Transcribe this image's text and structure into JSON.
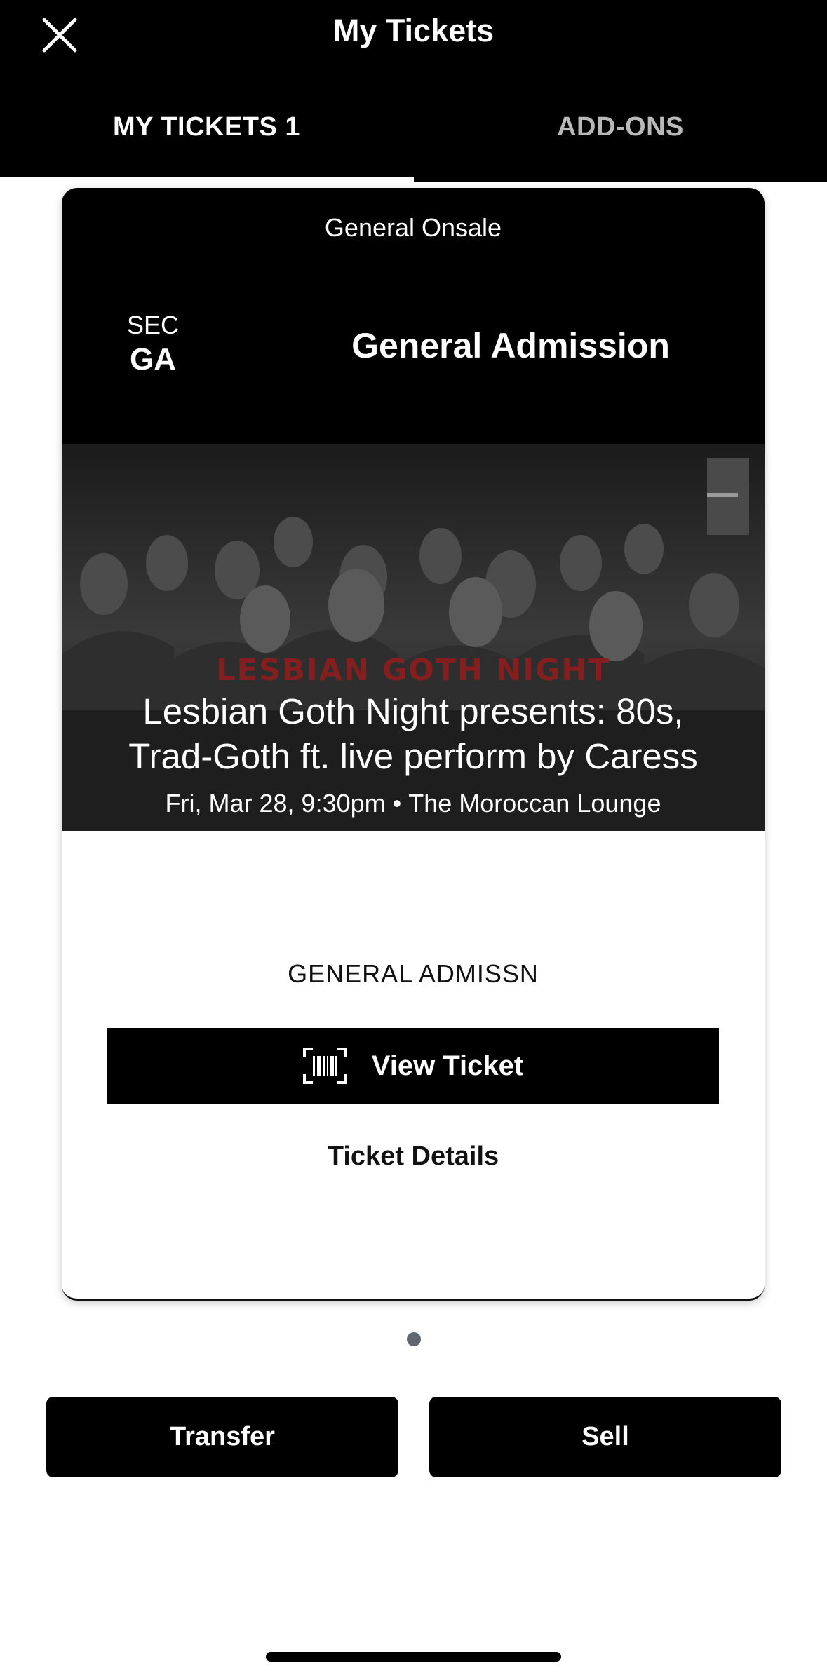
{
  "header": {
    "title": "My Tickets",
    "close_icon": "close-icon",
    "tabs": [
      {
        "label": "MY TICKETS 1",
        "active": true
      },
      {
        "label": "ADD-ONS",
        "active": false
      }
    ]
  },
  "ticket": {
    "onsale_label": "General Onsale",
    "section_label": "SEC",
    "section_value": "GA",
    "admission_title": "General Admission",
    "image_brand_text": "LESBIAN GOTH NIGHT",
    "event_name_line1": "Lesbian Goth Night presents: 80s,",
    "event_name_line2": "Trad-Goth ft. live perform by Caress",
    "event_date": "Fri, Mar 28, 9:30pm",
    "meta_separator": "•",
    "venue": "The Moroccan Lounge",
    "ticket_type": "GENERAL ADMISSN",
    "view_ticket_label": "View Ticket",
    "view_ticket_icon": "barcode-scan-icon",
    "ticket_details_label": "Ticket Details"
  },
  "pager": {
    "current": 1,
    "total": 1
  },
  "actions": {
    "transfer_label": "Transfer",
    "sell_label": "Sell"
  },
  "colors": {
    "header_bg": "#000000",
    "active_tab": "#ffffff",
    "inactive_tab": "#b9b9b9",
    "brand_text": "#8a1f1f",
    "button_bg": "#000000",
    "pager_dot": "#5f6670"
  }
}
